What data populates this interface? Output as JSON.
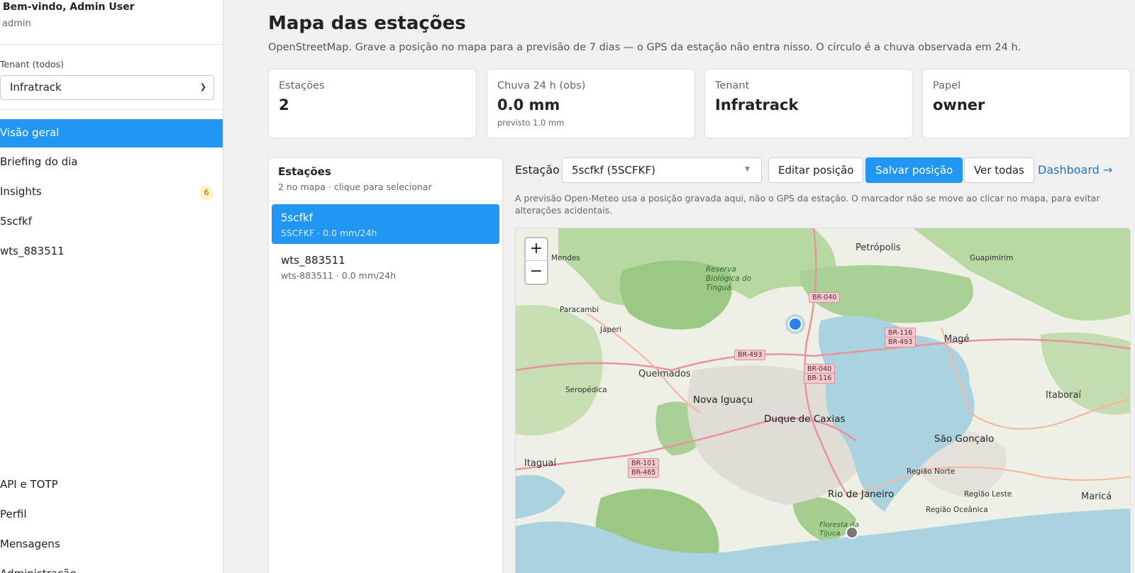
{
  "sidebar": {
    "welcome": "Bem-vindo, Admin User",
    "role": "admin",
    "tenant_label": "Tenant (todos)",
    "tenant_value": "Infratrack",
    "nav": [
      {
        "label": "Visão geral",
        "active": true
      },
      {
        "label": "Briefing do dia"
      },
      {
        "label": "Insights",
        "badge": "6"
      },
      {
        "label": "5scfkf"
      },
      {
        "label": "wts_883511"
      }
    ],
    "bottom_nav": [
      "API e TOTP",
      "Perfil",
      "Mensagens",
      "Administração"
    ]
  },
  "page": {
    "title": "Mapa das estações",
    "subtitle": "OpenStreetMap. Grave a posição no mapa para a previsão de 7 dias — o GPS da estação não entra nisso. O círculo é a chuva observada em 24 h."
  },
  "cards": [
    {
      "label": "Estações",
      "value": "2",
      "note": ""
    },
    {
      "label": "Chuva 24 h (obs)",
      "value": "0.0 mm",
      "note": "previsto 1.0 mm"
    },
    {
      "label": "Tenant",
      "value": "Infratrack",
      "note": ""
    },
    {
      "label": "Papel",
      "value": "owner",
      "note": ""
    }
  ],
  "stations_panel": {
    "title": "Estações",
    "hint": "2 no mapa · clique para selecionar",
    "items": [
      {
        "name": "5scfkf",
        "meta": "5SCFKF · 0.0 mm/24h",
        "selected": true
      },
      {
        "name": "wts_883511",
        "meta": "wts-883511 · 0.0 mm/24h",
        "selected": false
      }
    ]
  },
  "toolbar": {
    "station_label": "Estação",
    "station_value": "5scfkf (5SCFKF)",
    "edit_label": "Editar posição",
    "save_label": "Salvar posição",
    "view_all_label": "Ver todas",
    "dashboard_link": "Dashboard →",
    "note": "A previsão Open-Meteo usa a posição gravada aqui, não o GPS da estação. O marcador não se move ao clicar no mapa, para evitar alterações acidentais."
  },
  "map": {
    "zoom_in": "+",
    "zoom_out": "−",
    "places": [
      {
        "label": "Petrópolis"
      },
      {
        "label": "Guapimirim"
      },
      {
        "label": "Mendes"
      },
      {
        "label": "Paracambi"
      },
      {
        "label": "Japeri"
      },
      {
        "label": "Queimados"
      },
      {
        "label": "Seropédica"
      },
      {
        "label": "Nova Iguaçu"
      },
      {
        "label": "Duque de Caxias"
      },
      {
        "label": "Magé"
      },
      {
        "label": "Itaboraí"
      },
      {
        "label": "São Gonçalo"
      },
      {
        "label": "Itaguaí"
      },
      {
        "label": "Rio de Janeiro"
      },
      {
        "label": "Região Norte"
      },
      {
        "label": "Região Leste"
      },
      {
        "label": "Região Oceânica"
      },
      {
        "label": "Maricá"
      },
      {
        "label": "Reserva Biológica do Tinguá"
      },
      {
        "label": "Floresta da Tijuca"
      }
    ],
    "roads": [
      "BR-040",
      "BR-116",
      "BR-493",
      "BR-493",
      "BR-040",
      "BR-116",
      "BR-101",
      "BR-465"
    ],
    "colors": {
      "marker_selected": "#2f80ed",
      "marker_other": "#777777",
      "water": "#aad3df",
      "forest": "#94c279"
    }
  }
}
